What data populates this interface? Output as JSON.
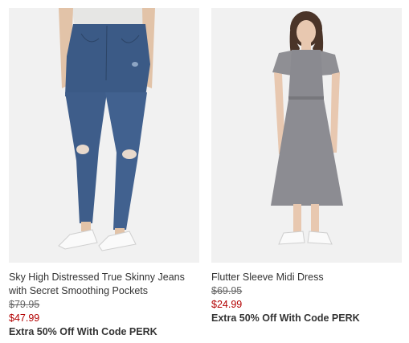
{
  "products": [
    {
      "name": "Sky High Distressed True Skinny Jeans with Secret Smoothing Pockets",
      "was_price": "$79.95",
      "sale_price": "$47.99",
      "promo": "Extra 50% Off With Code PERK",
      "image": "jeans-photo"
    },
    {
      "name": "Flutter Sleeve Midi Dress",
      "was_price": "$69.95",
      "sale_price": "$24.99",
      "promo": "Extra 50% Off With Code PERK",
      "image": "dress-photo"
    }
  ],
  "colors": {
    "sale": "#b30000",
    "text": "#333333",
    "image_bg": "#f1f1f1"
  }
}
